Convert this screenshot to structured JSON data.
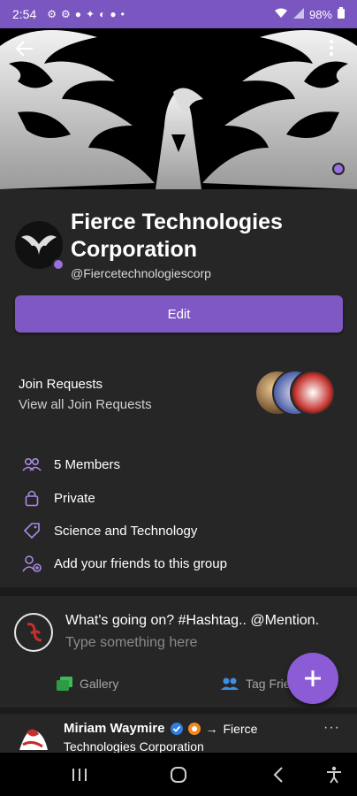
{
  "status_bar": {
    "time": "2:54",
    "notification_icons": [
      "gear-icon",
      "gear-icon",
      "pinterest-icon",
      "twitter-icon",
      "game-icon",
      "facebook-icon",
      "dot-icon"
    ],
    "battery": "98%"
  },
  "cover": {
    "back_icon": "arrow-left-icon",
    "more_icon": "more-vertical-icon"
  },
  "group": {
    "name": "Fierce Technologies Corporation",
    "handle": "@Fiercetechnologiescorp",
    "edit_label": "Edit"
  },
  "join_requests": {
    "title": "Join Requests",
    "link": "View all Join Requests"
  },
  "info": [
    {
      "icon": "members-icon",
      "text": "5 Members"
    },
    {
      "icon": "lock-icon",
      "text": "Private"
    },
    {
      "icon": "tag-icon",
      "text": "Science and Technology"
    },
    {
      "icon": "add-user-icon",
      "text": "Add your friends to this group"
    }
  ],
  "composer": {
    "title": "What's going on? #Hashtag.. @Mention.",
    "placeholder": "Type something here",
    "gallery_label": "Gallery",
    "tag_label": "Tag Frie"
  },
  "post": {
    "author": "Miriam Waymire",
    "arrow": "→",
    "target_part1": "Fierce",
    "target_part2": "Technologies Corporation",
    "more": "···"
  },
  "colors": {
    "accent": "#7f58c4",
    "status_bar": "#7a56c1",
    "background": "#262626"
  }
}
